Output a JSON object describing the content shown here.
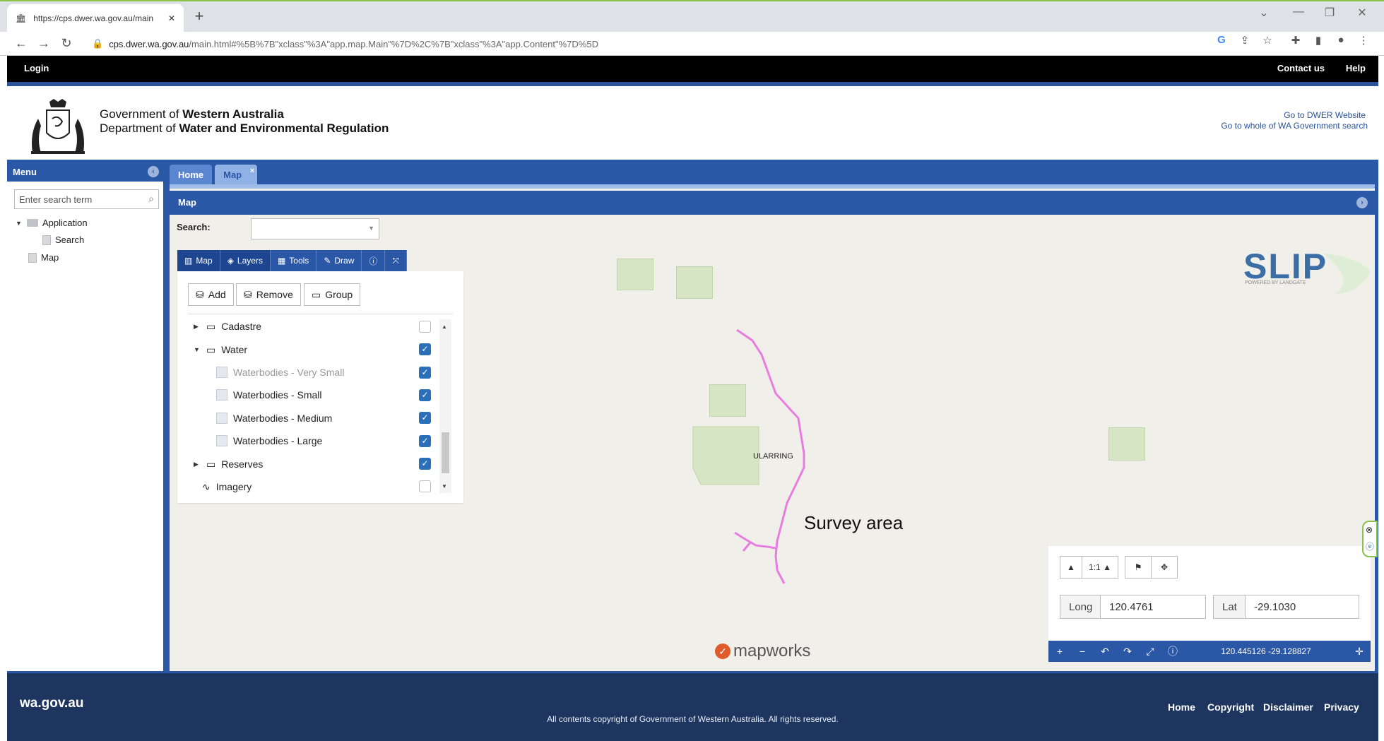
{
  "browser": {
    "tab_title": "https://cps.dwer.wa.gov.au/main",
    "url_host": "cps.dwer.wa.gov.au",
    "url_rest": "/main.html#%5B%7B\"xclass\"%3A\"app.map.Main\"%7D%2C%7B\"xclass\"%3A\"app.Content\"%7D%5D"
  },
  "topbar": {
    "login": "Login",
    "contact": "Contact us",
    "help": "Help"
  },
  "header": {
    "gov_prefix": "Government of",
    "gov_name": "Western Australia",
    "dept_prefix": "Department of",
    "dept_name": "Water and Environmental Regulation",
    "link1": "Go to DWER Website",
    "link2": "Go to whole of WA Government search"
  },
  "sidebar": {
    "title": "Menu",
    "search_placeholder": "Enter search term",
    "items": [
      {
        "label": "Application"
      },
      {
        "label": "Search"
      },
      {
        "label": "Map"
      }
    ]
  },
  "tabs": [
    {
      "label": "Home"
    },
    {
      "label": "Map"
    }
  ],
  "map": {
    "title": "Map",
    "search_label": "Search:"
  },
  "map_toolbar": [
    {
      "label": "Map"
    },
    {
      "label": "Layers"
    },
    {
      "label": "Tools"
    },
    {
      "label": "Draw"
    }
  ],
  "layers_panel": {
    "add": "Add",
    "remove": "Remove",
    "group": "Group",
    "layers": [
      {
        "label": "Cadastre",
        "checked": false
      },
      {
        "label": "Water",
        "checked": true
      },
      {
        "label": "Waterbodies - Very Small",
        "checked": true
      },
      {
        "label": "Waterbodies - Small",
        "checked": true
      },
      {
        "label": "Waterbodies - Medium",
        "checked": true
      },
      {
        "label": "Waterbodies - Large",
        "checked": true
      },
      {
        "label": "Reserves",
        "checked": true
      },
      {
        "label": "Imagery",
        "checked": false
      }
    ]
  },
  "map_labels": {
    "town": "ULARRING",
    "survey": "Survey area",
    "slip": "SLIP",
    "slip_sub": "POWERED BY LANDGATE",
    "mapworks": "mapworks"
  },
  "nav_panel": {
    "scale": "1:1",
    "long_label": "Long",
    "long_value": "120.4761",
    "lat_label": "Lat",
    "lat_value": "-29.1030",
    "readout": "120.445126 -29.128827"
  },
  "footer": {
    "site": "wa.gov.au",
    "links": [
      {
        "label": "Home"
      },
      {
        "label": "Copyright"
      },
      {
        "label": "Disclaimer"
      },
      {
        "label": "Privacy"
      }
    ],
    "copyright": "All contents copyright of Government of Western Australia. All rights reserved."
  }
}
